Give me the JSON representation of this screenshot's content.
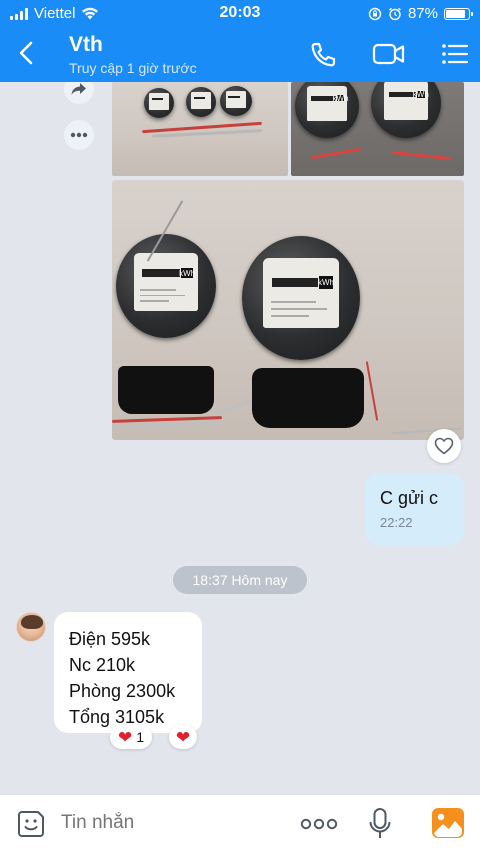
{
  "status_bar": {
    "carrier": "Viettel",
    "time": "20:03",
    "battery": "87%",
    "battery_level": 0.87
  },
  "header": {
    "title": "Vth",
    "subtitle": "Truy cập 1 giờ trước"
  },
  "messages": {
    "outgoing": {
      "text": "C gửi c",
      "time": "22:22"
    },
    "time_separator": "18:37 Hôm nay",
    "incoming": {
      "lines": [
        "Điện 595k",
        "Nc 210k",
        "Phòng 2300k",
        "Tổng 3105k"
      ]
    },
    "reactions": [
      {
        "emoji": "heart",
        "count": "1"
      },
      {
        "emoji": "heart",
        "count": ""
      }
    ]
  },
  "composer": {
    "placeholder": "Tin nhắn"
  },
  "colors": {
    "header_bg": "#1a8cf7",
    "chat_bg": "#e2e6ec",
    "outgoing_bubble": "#d5ecfb",
    "incoming_bubble": "#ffffff",
    "reaction_heart": "#e0202e",
    "gallery_icon": "#f5901f"
  },
  "icons": [
    "back-arrow-icon",
    "phone-icon",
    "video-call-icon",
    "menu-list-icon",
    "share-icon",
    "more-icon",
    "heart-icon",
    "sticker-icon",
    "more-options-icon",
    "microphone-icon",
    "gallery-icon"
  ]
}
